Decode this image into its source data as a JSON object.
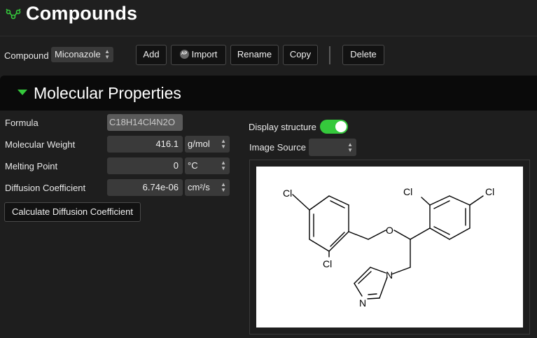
{
  "header": {
    "title": "Compounds",
    "logo_icon": "molecule-icon",
    "accent_color": "#35c93c"
  },
  "toolbar": {
    "compound_label": "Compound",
    "compound_value": "Miconazole",
    "add_label": "Add",
    "import_label": "Import",
    "import_badge": "AP",
    "rename_label": "Rename",
    "copy_label": "Copy",
    "delete_label": "Delete"
  },
  "section": {
    "title": "Molecular Properties",
    "expanded": true
  },
  "properties": {
    "formula": {
      "label": "Formula",
      "value": "C18H14Cl4N2O"
    },
    "molecular_weight": {
      "label": "Molecular Weight",
      "value": "416.1",
      "unit": "g/mol"
    },
    "melting_point": {
      "label": "Melting Point",
      "value": "0",
      "unit": "°C"
    },
    "diffusion_coefficient": {
      "label": "Diffusion Coefficient",
      "value": "6.74e-06",
      "unit": "cm²/s"
    },
    "calculate_label": "Calculate Diffusion Coefficient"
  },
  "structure": {
    "display_label": "Display structure",
    "display_on": true,
    "image_source_label": "Image Source",
    "image_source_value": "",
    "atoms": {
      "cl_top_left": "Cl",
      "cl_bottom_left": "Cl",
      "cl_top_mid": "Cl",
      "cl_top_right": "Cl",
      "oxygen": "O",
      "n_imidazole_1": "N",
      "n_imidazole_2": "N"
    }
  }
}
